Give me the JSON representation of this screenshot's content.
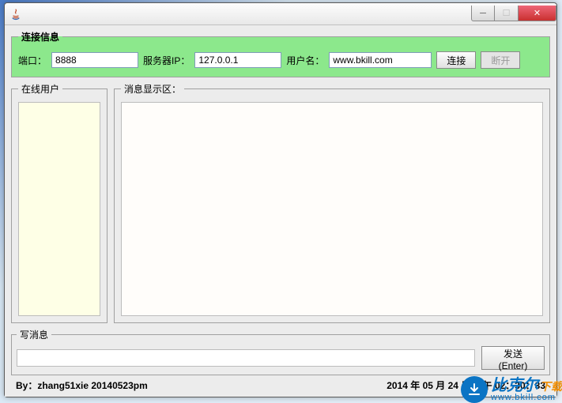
{
  "titlebar": {
    "title": ""
  },
  "conn": {
    "legend": "连接信息",
    "port_label": "端口：",
    "port_value": "8888",
    "server_label": "服务器IP：",
    "server_value": "127.0.0.1",
    "user_label": "用户名：",
    "user_value": "www.bkill.com",
    "connect_label": "连接",
    "disconnect_label": "断开"
  },
  "users": {
    "legend": "在线用户"
  },
  "messages": {
    "legend": "消息显示区："
  },
  "write": {
    "legend": "写消息",
    "input_value": "",
    "send_label": "发送(Enter)"
  },
  "status": {
    "author": "By：zhang51xie 20140523pm",
    "timestamp": "2014 年 05 月 24 日 上午  02：30：33"
  },
  "watermark": {
    "brand": "比克尔",
    "sub": "下载",
    "url": "www.bkill.com"
  }
}
